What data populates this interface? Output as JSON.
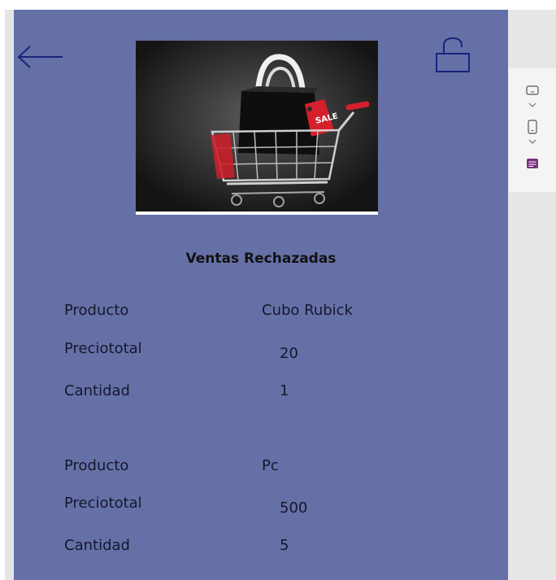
{
  "header": {
    "back_icon": "arrow-left-icon",
    "lock_icon": "unlock-icon",
    "image_text": "SALE"
  },
  "section_title": "Ventas Rechazadas",
  "records": [
    {
      "producto_label": "Producto",
      "producto_value": "Cubo Rubick",
      "precio_label": "Preciototal",
      "precio_value": "20",
      "cantidad_label": "Cantidad",
      "cantidad_value": "1"
    },
    {
      "producto_label": "Producto",
      "producto_value": "Pc",
      "precio_label": "Preciototal",
      "precio_value": "500",
      "cantidad_label": "Cantidad",
      "cantidad_value": "5"
    }
  ],
  "side_panel": {
    "icons": [
      "tablet-landscape-icon",
      "chevron-down-icon",
      "phone-icon",
      "chevron-down-icon",
      "form-icon"
    ]
  },
  "colors": {
    "screen_background": "#6570a6",
    "icon_color": "#1a237e",
    "form_icon_color": "#7a2e7f"
  }
}
